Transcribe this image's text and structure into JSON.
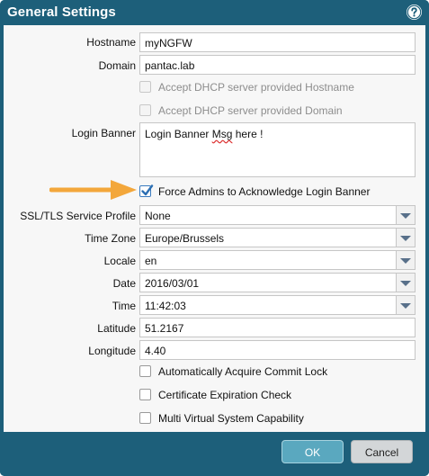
{
  "dialog": {
    "title": "General Settings",
    "help_icon": "help-icon"
  },
  "form": {
    "hostname": {
      "label": "Hostname",
      "value": "myNGFW"
    },
    "domain": {
      "label": "Domain",
      "value": "pantac.lab"
    },
    "dhcp_hostname": {
      "label": "Accept DHCP server provided Hostname",
      "checked": false,
      "disabled": true
    },
    "dhcp_domain": {
      "label": "Accept DHCP server provided Domain",
      "checked": false,
      "disabled": true
    },
    "login_banner": {
      "label": "Login Banner",
      "value_pre": "Login Banner ",
      "value_misspelled": "Msg",
      "value_post": " here !"
    },
    "force_ack": {
      "label": "Force Admins to Acknowledge Login Banner",
      "checked": true
    },
    "ssl_profile": {
      "label": "SSL/TLS Service Profile",
      "value": "None"
    },
    "time_zone": {
      "label": "Time Zone",
      "value": "Europe/Brussels"
    },
    "locale": {
      "label": "Locale",
      "value": "en"
    },
    "date": {
      "label": "Date",
      "value": "2016/03/01"
    },
    "time": {
      "label": "Time",
      "value": "11:42:03"
    },
    "latitude": {
      "label": "Latitude",
      "value": "51.2167"
    },
    "longitude": {
      "label": "Longitude",
      "value": "4.40"
    },
    "commit_lock": {
      "label": "Automatically Acquire Commit Lock",
      "checked": false
    },
    "cert_check": {
      "label": "Certificate Expiration Check",
      "checked": false
    },
    "multi_vsys": {
      "label": "Multi Virtual System Capability",
      "checked": false
    }
  },
  "buttons": {
    "ok": "OK",
    "cancel": "Cancel"
  },
  "colors": {
    "header": "#1d5f7a",
    "ok_button": "#5aa8bf",
    "annotation_arrow": "#f3a73b",
    "checkbox_check": "#2c6fb3"
  }
}
